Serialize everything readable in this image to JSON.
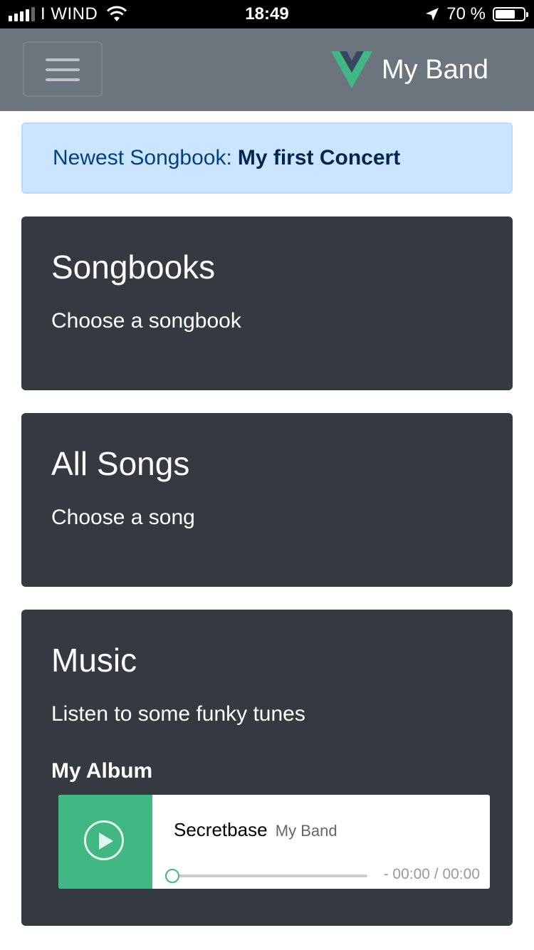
{
  "status_bar": {
    "carrier": "I WIND",
    "time": "18:49",
    "battery_text": "70 %",
    "battery_level": 0.7,
    "signal_bars": 4
  },
  "navbar": {
    "brand": "My Band",
    "brand_colors": {
      "outer": "#41b883",
      "inner": "#35495e"
    },
    "menu_icon": "hamburger-icon"
  },
  "alert": {
    "prefix": "Newest Songbook:",
    "songbook": "My first Concert"
  },
  "cards": [
    {
      "title": "Songbooks",
      "text": "Choose a songbook"
    },
    {
      "title": "All Songs",
      "text": "Choose a song"
    },
    {
      "title": "Music",
      "text": "Listen to some funky tunes"
    }
  ],
  "music": {
    "album_title": "My Album",
    "player": {
      "song_title": "Secretbase",
      "artist": "My Band",
      "time": "- 00:00 / 00:00",
      "progress": 0,
      "accent": "#41b883",
      "play_icon": "play-icon"
    }
  },
  "colors": {
    "navbar_bg": "#6c757d",
    "card_bg": "#343a40",
    "alert_bg": "#cce5ff",
    "alert_text": "#004085"
  }
}
